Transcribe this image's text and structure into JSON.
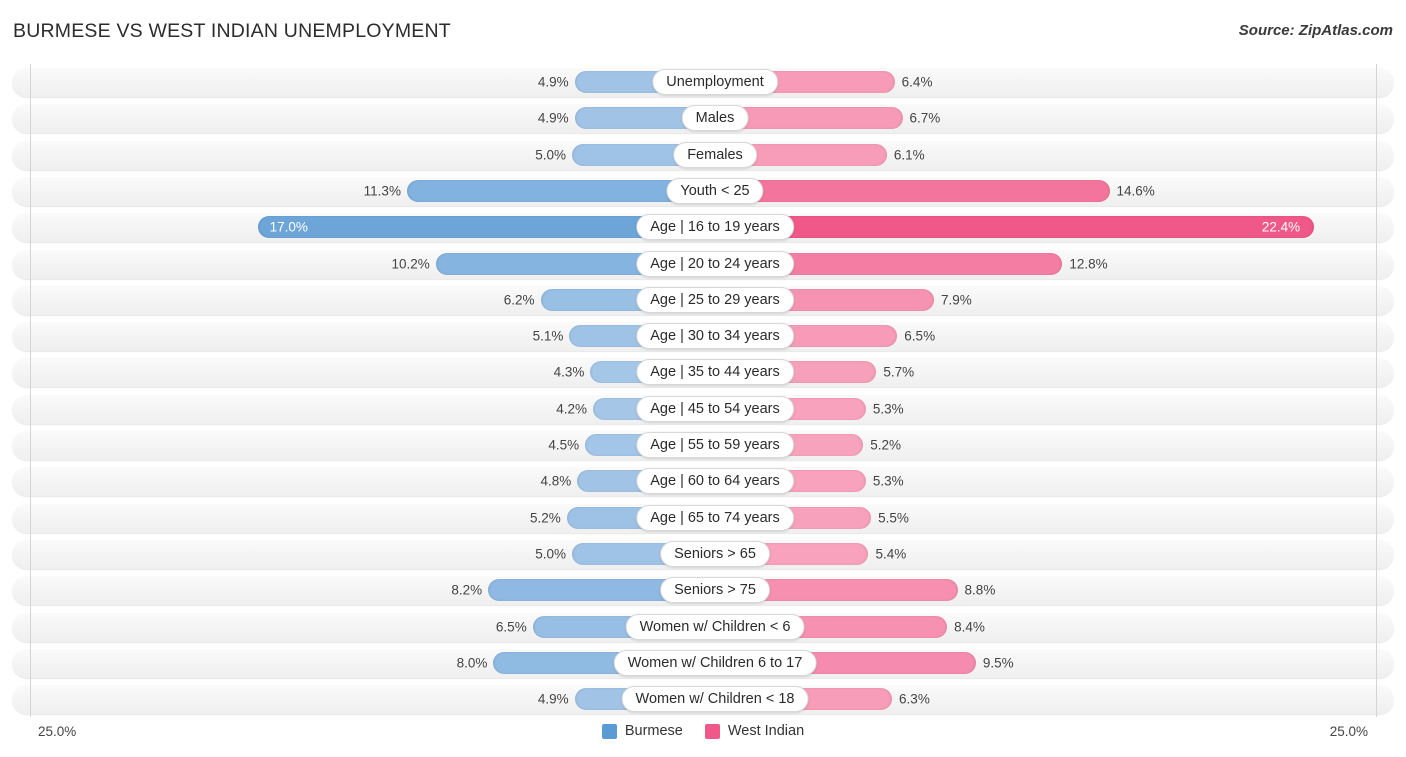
{
  "header": {
    "title": "BURMESE VS WEST INDIAN UNEMPLOYMENT",
    "source": "Source: ZipAtlas.com"
  },
  "axis": {
    "left_scale_label": "25.0%",
    "right_scale_label": "25.0%",
    "max": 25.0
  },
  "legend": {
    "items": [
      {
        "label": "Burmese",
        "color": "#5b9bd5"
      },
      {
        "label": "West Indian",
        "color": "#f0588a"
      }
    ]
  },
  "colors": {
    "burmese_light": "#a8c8e8",
    "burmese_dark": "#5b9bd5",
    "west_indian_light": "#f9aec6",
    "west_indian_dark": "#f0588a",
    "row_background": "#f4f4f4",
    "axis_line": "#d3d3d8"
  },
  "chart_data": {
    "type": "bar",
    "orientation": "horizontal-diverging",
    "title": "BURMESE VS WEST INDIAN UNEMPLOYMENT",
    "xlabel": "",
    "ylabel": "",
    "xlim": [
      25.0,
      25.0
    ],
    "grid": false,
    "legend_position": "bottom-center",
    "categories": [
      "Unemployment",
      "Males",
      "Females",
      "Youth < 25",
      "Age | 16 to 19 years",
      "Age | 20 to 24 years",
      "Age | 25 to 29 years",
      "Age | 30 to 34 years",
      "Age | 35 to 44 years",
      "Age | 45 to 54 years",
      "Age | 55 to 59 years",
      "Age | 60 to 64 years",
      "Age | 65 to 74 years",
      "Seniors > 65",
      "Seniors > 75",
      "Women w/ Children < 6",
      "Women w/ Children 6 to 17",
      "Women w/ Children < 18"
    ],
    "series": [
      {
        "name": "Burmese",
        "color": "#5b9bd5",
        "values": [
          4.9,
          4.9,
          5.0,
          11.3,
          17.0,
          10.2,
          6.2,
          5.1,
          4.3,
          4.2,
          4.5,
          4.8,
          5.2,
          5.0,
          8.2,
          6.5,
          8.0,
          4.9
        ],
        "labels": [
          "4.9%",
          "4.9%",
          "5.0%",
          "11.3%",
          "17.0%",
          "10.2%",
          "6.2%",
          "5.1%",
          "4.3%",
          "4.2%",
          "4.5%",
          "4.8%",
          "5.2%",
          "5.0%",
          "8.2%",
          "6.5%",
          "8.0%",
          "4.9%"
        ]
      },
      {
        "name": "West Indian",
        "color": "#f0588a",
        "values": [
          6.4,
          6.7,
          6.1,
          14.6,
          22.4,
          12.8,
          7.9,
          6.5,
          5.7,
          5.3,
          5.2,
          5.3,
          5.5,
          5.4,
          8.8,
          8.4,
          9.5,
          6.3
        ],
        "labels": [
          "6.4%",
          "6.7%",
          "6.1%",
          "14.6%",
          "22.4%",
          "12.8%",
          "7.9%",
          "6.5%",
          "5.7%",
          "5.3%",
          "5.2%",
          "5.3%",
          "5.5%",
          "5.4%",
          "8.8%",
          "8.4%",
          "9.5%",
          "6.3%"
        ]
      }
    ]
  },
  "rows": [
    {
      "label": "Unemployment",
      "left_value": 4.9,
      "left_label": "4.9%",
      "right_value": 6.4,
      "right_label": "6.4%"
    },
    {
      "label": "Males",
      "left_value": 4.9,
      "left_label": "4.9%",
      "right_value": 6.7,
      "right_label": "6.7%"
    },
    {
      "label": "Females",
      "left_value": 5.0,
      "left_label": "5.0%",
      "right_value": 6.1,
      "right_label": "6.1%"
    },
    {
      "label": "Youth < 25",
      "left_value": 11.3,
      "left_label": "11.3%",
      "right_value": 14.6,
      "right_label": "14.6%"
    },
    {
      "label": "Age | 16 to 19 years",
      "left_value": 17.0,
      "left_label": "17.0%",
      "right_value": 22.4,
      "right_label": "22.4%"
    },
    {
      "label": "Age | 20 to 24 years",
      "left_value": 10.2,
      "left_label": "10.2%",
      "right_value": 12.8,
      "right_label": "12.8%"
    },
    {
      "label": "Age | 25 to 29 years",
      "left_value": 6.2,
      "left_label": "6.2%",
      "right_value": 7.9,
      "right_label": "7.9%"
    },
    {
      "label": "Age | 30 to 34 years",
      "left_value": 5.1,
      "left_label": "5.1%",
      "right_value": 6.5,
      "right_label": "6.5%"
    },
    {
      "label": "Age | 35 to 44 years",
      "left_value": 4.3,
      "left_label": "4.3%",
      "right_value": 5.7,
      "right_label": "5.7%"
    },
    {
      "label": "Age | 45 to 54 years",
      "left_value": 4.2,
      "left_label": "4.2%",
      "right_value": 5.3,
      "right_label": "5.3%"
    },
    {
      "label": "Age | 55 to 59 years",
      "left_value": 4.5,
      "left_label": "4.5%",
      "right_value": 5.2,
      "right_label": "5.2%"
    },
    {
      "label": "Age | 60 to 64 years",
      "left_value": 4.8,
      "left_label": "4.8%",
      "right_value": 5.3,
      "right_label": "5.3%"
    },
    {
      "label": "Age | 65 to 74 years",
      "left_value": 5.2,
      "left_label": "5.2%",
      "right_value": 5.5,
      "right_label": "5.5%"
    },
    {
      "label": "Seniors > 65",
      "left_value": 5.0,
      "left_label": "5.0%",
      "right_value": 5.4,
      "right_label": "5.4%"
    },
    {
      "label": "Seniors > 75",
      "left_value": 8.2,
      "left_label": "8.2%",
      "right_value": 8.8,
      "right_label": "8.8%"
    },
    {
      "label": "Women w/ Children < 6",
      "left_value": 6.5,
      "left_label": "6.5%",
      "right_value": 8.4,
      "right_label": "8.4%"
    },
    {
      "label": "Women w/ Children 6 to 17",
      "left_value": 8.0,
      "left_label": "8.0%",
      "right_value": 9.5,
      "right_label": "9.5%"
    },
    {
      "label": "Women w/ Children < 18",
      "left_value": 4.9,
      "left_label": "4.9%",
      "right_value": 6.3,
      "right_label": "6.3%"
    }
  ]
}
